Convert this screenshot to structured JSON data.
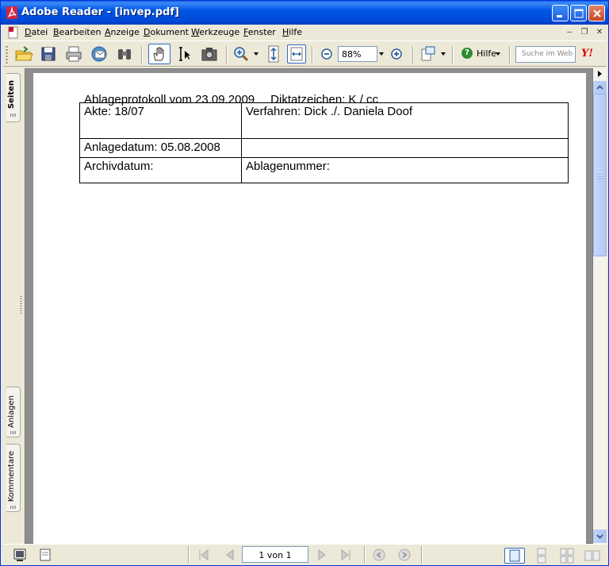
{
  "window": {
    "title": "Adobe Reader - [invep.pdf]"
  },
  "menu": [
    "Datei",
    "Bearbeiten",
    "Anzeige",
    "Dokument",
    "Werkzeuge",
    "Fenster",
    "Hilfe"
  ],
  "toolbar": {
    "zoom_value": "88%",
    "help_label": "Hilfe",
    "search_placeholder": "Suche im Web",
    "yahoo_label": "Y!"
  },
  "nav_tabs": {
    "pages": "Seiten",
    "attachments": "Anlagen",
    "comments": "Kommentare"
  },
  "document": {
    "heading": "Ablageprotokoll vom 23.09.2009",
    "dictation": "Diktatzeichen:  K / cc",
    "rows": [
      [
        "Akte: 18/07",
        "Verfahren: Dick ./. Daniela Doof"
      ],
      [
        "Anlagedatum: 05.08.2008",
        ""
      ],
      [
        "Archivdatum:",
        "Ablagenummer:"
      ]
    ]
  },
  "status": {
    "page_indicator": "1 von 1"
  },
  "colors": {
    "titlebar": "#0055E5",
    "chrome": "#ECE9D8",
    "doc_bg": "#8E8E8E"
  }
}
